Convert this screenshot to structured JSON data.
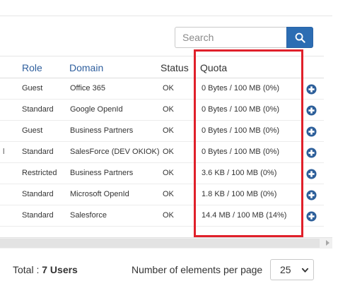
{
  "search": {
    "placeholder": "Search",
    "icon": "search-icon"
  },
  "table": {
    "truncated_char": "l",
    "columns": {
      "role": "Role",
      "domain": "Domain",
      "status": "Status",
      "quota": "Quota"
    },
    "rows": [
      {
        "role": "Guest",
        "domain": "Office 365",
        "status": "OK",
        "quota": "0 Bytes / 100 MB (0%)"
      },
      {
        "role": "Standard",
        "domain": "Google OpenId",
        "status": "OK",
        "quota": "0 Bytes / 100 MB (0%)"
      },
      {
        "role": "Guest",
        "domain": "Business Partners",
        "status": "OK",
        "quota": "0 Bytes / 100 MB (0%)"
      },
      {
        "role": "Standard",
        "domain": "SalesForce (DEV OKIOK)",
        "status": "OK",
        "quota": "0 Bytes / 100 MB (0%)"
      },
      {
        "role": "Restricted",
        "domain": "Business Partners",
        "status": "OK",
        "quota": "3.6 KB / 100 MB (0%)"
      },
      {
        "role": "Standard",
        "domain": "Microsoft OpenId",
        "status": "OK",
        "quota": "1.8 KB / 100 MB (0%)"
      },
      {
        "role": "Standard",
        "domain": "Salesforce",
        "status": "OK",
        "quota": "14.4 MB / 100 MB (14%)"
      }
    ]
  },
  "footer": {
    "total_label": "Total : ",
    "total_value": "7 Users",
    "per_page_label": "Number of elements per page",
    "per_page_value": "25"
  },
  "colors": {
    "accent": "#2c6db3",
    "header_link": "#2f5f9e",
    "highlight": "#e0202a",
    "add_icon": "#2d5f9a"
  }
}
